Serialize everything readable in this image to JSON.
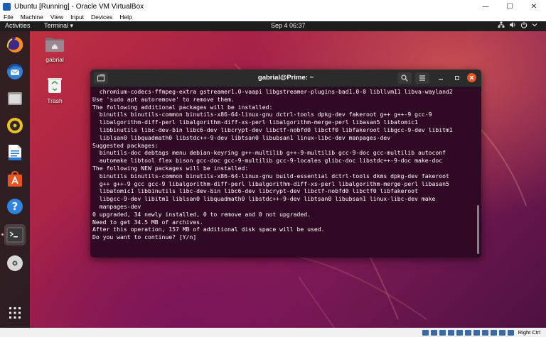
{
  "vbox": {
    "title": "Ubuntu [Running] - Oracle VM VirtualBox",
    "menu": [
      "File",
      "Machine",
      "View",
      "Input",
      "Devices",
      "Help"
    ],
    "status_right": "Right Ctrl"
  },
  "topbar": {
    "activities": "Activities",
    "app_menu": "Terminal ▾",
    "clock": "Sep 4  06:37",
    "tray_icons": [
      "network-icon",
      "volume-icon",
      "power-icon",
      "menu-chevron-icon"
    ]
  },
  "dock": {
    "items": [
      "firefox",
      "thunderbird",
      "files",
      "rhythmbox",
      "libreoffice-writer",
      "ubuntu-software",
      "help",
      "terminal",
      "dvd"
    ],
    "show_apps": "show-applications"
  },
  "desktop": {
    "home_label": "gabrial",
    "trash_label": "Trash"
  },
  "terminal": {
    "title": "gabrial@Prime: ~",
    "lines": [
      "  chromium-codecs-ffmpeg-extra gstreamer1.0-vaapi libgstreamer-plugins-bad1.0-0 libllvm11 libva-wayland2",
      "Use 'sudo apt autoremove' to remove them.",
      "The following additional packages will be installed:",
      "  binutils binutils-common binutils-x86-64-linux-gnu dctrl-tools dpkg-dev fakeroot g++ g++-9 gcc-9",
      "  libalgorithm-diff-perl libalgorithm-diff-xs-perl libalgorithm-merge-perl libasan5 libatomic1",
      "  libbinutils libc-dev-bin libc6-dev libcrypt-dev libctf-nobfd0 libctf0 libfakeroot libgcc-9-dev libitm1",
      "  liblsan0 libquadmath0 libstdc++-9-dev libtsan0 libubsan1 linux-libc-dev manpages-dev",
      "Suggested packages:",
      "  binutils-doc debtags menu debian-keyring g++-multilib g++-9-multilib gcc-9-doc gcc-multilib autoconf",
      "  automake libtool flex bison gcc-doc gcc-9-multilib gcc-9-locales glibc-doc libstdc++-9-doc make-doc",
      "The following NEW packages will be installed:",
      "  binutils binutils-common binutils-x86-64-linux-gnu build-essential dctrl-tools dkms dpkg-dev fakeroot",
      "  g++ g++-9 gcc gcc-9 libalgorithm-diff-perl libalgorithm-diff-xs-perl libalgorithm-merge-perl libasan5",
      "  libatomic1 libbinutils libc-dev-bin libc6-dev libcrypt-dev libctf-nobfd0 libctf0 libfakeroot",
      "  libgcc-9-dev libitm1 liblsan0 libquadmath0 libstdc++-9-dev libtsan0 libubsan1 linux-libc-dev make",
      "  manpages-dev",
      "0 upgraded, 34 newly installed, 0 to remove and 0 not upgraded.",
      "Need to get 34.5 MB of archives.",
      "After this operation, 157 MB of additional disk space will be used.",
      "Do you want to continue? [Y/n]"
    ]
  }
}
